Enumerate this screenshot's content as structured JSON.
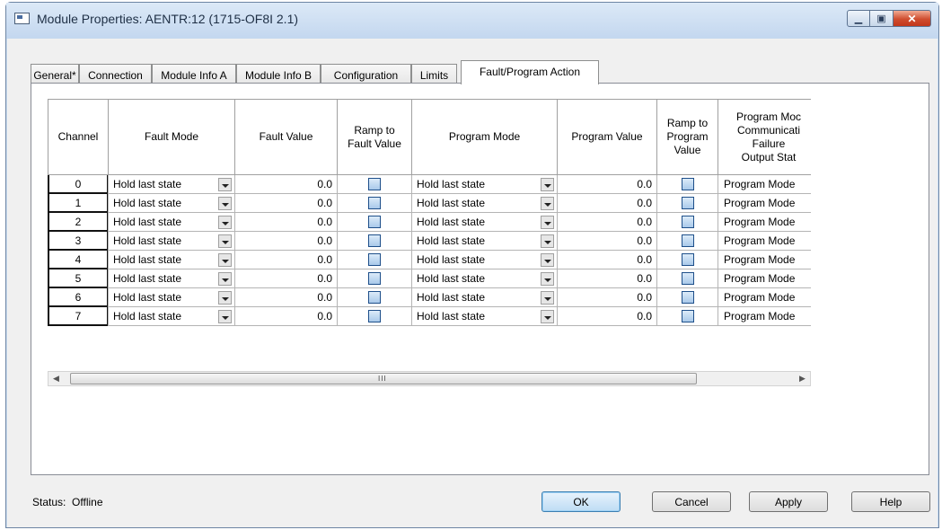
{
  "window": {
    "title": "Module Properties: AENTR:12 (1715-OF8I 2.1)",
    "controls": {
      "minimize": "minimize-icon",
      "maximize": "maximize-icon",
      "close": "close-icon"
    }
  },
  "tabs": [
    {
      "label": "General*",
      "active": false
    },
    {
      "label": "Connection",
      "active": false
    },
    {
      "label": "Module Info A",
      "active": false
    },
    {
      "label": "Module Info B",
      "active": false
    },
    {
      "label": "Configuration",
      "active": false
    },
    {
      "label": "Limits",
      "active": false
    },
    {
      "label": "Fault/Program Action",
      "active": true
    }
  ],
  "table": {
    "headers": {
      "channel": "Channel",
      "fault_mode": "Fault Mode",
      "fault_value": "Fault Value",
      "ramp_fault": [
        "Ramp to",
        "Fault Value"
      ],
      "program_mode": "Program Mode",
      "program_value": "Program Value",
      "ramp_program": [
        "Ramp to",
        "Program",
        "Value"
      ],
      "comm_failure": [
        "Program Moc",
        "Communicati",
        "Failure",
        "Output Stat"
      ]
    },
    "rows": [
      {
        "channel": "0",
        "fault_mode": "Hold last state",
        "fault_value": "0.0",
        "ramp_fault": false,
        "program_mode": "Hold last state",
        "program_value": "0.0",
        "ramp_program": false,
        "comm_failure": "Program Mode"
      },
      {
        "channel": "1",
        "fault_mode": "Hold last state",
        "fault_value": "0.0",
        "ramp_fault": false,
        "program_mode": "Hold last state",
        "program_value": "0.0",
        "ramp_program": false,
        "comm_failure": "Program Mode"
      },
      {
        "channel": "2",
        "fault_mode": "Hold last state",
        "fault_value": "0.0",
        "ramp_fault": false,
        "program_mode": "Hold last state",
        "program_value": "0.0",
        "ramp_program": false,
        "comm_failure": "Program Mode"
      },
      {
        "channel": "3",
        "fault_mode": "Hold last state",
        "fault_value": "0.0",
        "ramp_fault": false,
        "program_mode": "Hold last state",
        "program_value": "0.0",
        "ramp_program": false,
        "comm_failure": "Program Mode"
      },
      {
        "channel": "4",
        "fault_mode": "Hold last state",
        "fault_value": "0.0",
        "ramp_fault": false,
        "program_mode": "Hold last state",
        "program_value": "0.0",
        "ramp_program": false,
        "comm_failure": "Program Mode"
      },
      {
        "channel": "5",
        "fault_mode": "Hold last state",
        "fault_value": "0.0",
        "ramp_fault": false,
        "program_mode": "Hold last state",
        "program_value": "0.0",
        "ramp_program": false,
        "comm_failure": "Program Mode"
      },
      {
        "channel": "6",
        "fault_mode": "Hold last state",
        "fault_value": "0.0",
        "ramp_fault": false,
        "program_mode": "Hold last state",
        "program_value": "0.0",
        "ramp_program": false,
        "comm_failure": "Program Mode"
      },
      {
        "channel": "7",
        "fault_mode": "Hold last state",
        "fault_value": "0.0",
        "ramp_fault": false,
        "program_mode": "Hold last state",
        "program_value": "0.0",
        "ramp_program": false,
        "comm_failure": "Program Mode"
      }
    ],
    "scrollbar": {
      "left": "◀",
      "right": "▶",
      "grip": "III"
    }
  },
  "status": {
    "label": "Status:",
    "value": "Offline"
  },
  "buttons": {
    "ok": "OK",
    "cancel": "Cancel",
    "apply": "Apply",
    "help": "Help"
  }
}
